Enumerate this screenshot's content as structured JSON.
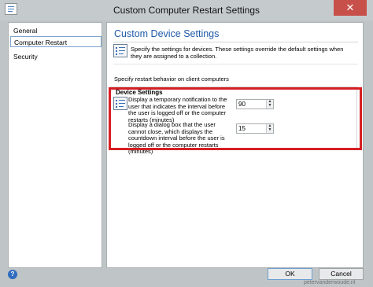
{
  "window": {
    "title": "Custom Computer Restart Settings",
    "close_label": "✕"
  },
  "nav": {
    "items": [
      {
        "label": "General",
        "selected": false
      },
      {
        "label": "Computer Restart",
        "selected": true
      },
      {
        "label": "Security",
        "selected": false
      }
    ]
  },
  "content": {
    "heading": "Custom Device Settings",
    "description": "Specify the settings for devices. These settings override the default settings when they are assigned to a collection.",
    "behavior_label": "Specify restart behavior on client computers",
    "group": {
      "label": "Device Settings",
      "settings": [
        {
          "text": "Display a temporary notification to the user that indicates the interval before the user is logged off or the computer restarts (minutes)",
          "value": "90"
        },
        {
          "text": "Display a dialog box that the user cannot close, which displays the countdown interval before the user is logged off or the computer restarts (minutes)",
          "value": "15"
        }
      ]
    }
  },
  "footer": {
    "help_label": "?",
    "ok_label": "OK",
    "cancel_label": "Cancel"
  },
  "watermark": "petervanderwoude.nl",
  "colors": {
    "heading": "#1e5aa8",
    "highlight": "#d61f24",
    "close": "#c7504a"
  }
}
